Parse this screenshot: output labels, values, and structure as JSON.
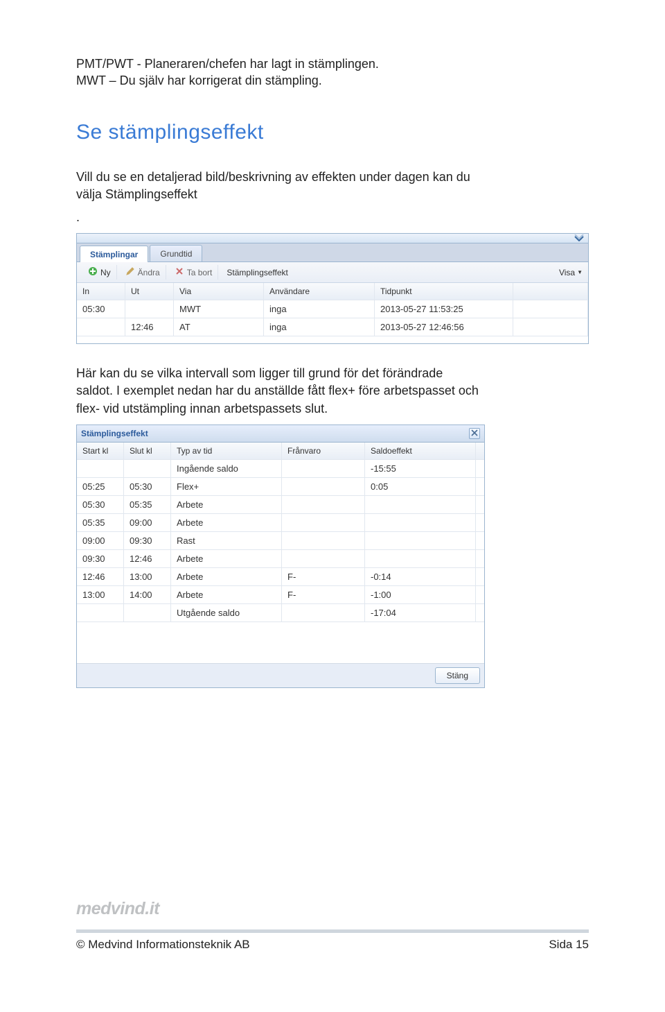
{
  "intro": {
    "line1": "PMT/PWT - Planeraren/chefen har lagt in stämplingen.",
    "line2": "MWT – Du själv har korrigerat din stämpling."
  },
  "heading": "Se stämplingseffekt",
  "body1_line1": "Vill du se en detaljerad bild/beskrivning av effekten under dagen kan du",
  "body1_line2": "välja Stämplingseffekt",
  "body1_period": ".",
  "panel1": {
    "tabs": {
      "t1": "Stämplingar",
      "t2": "Grundtid"
    },
    "toolbar": {
      "ny": "Ny",
      "andra": "Ändra",
      "tabort": "Ta bort",
      "link": "Stämplingseffekt",
      "visa": "Visa"
    },
    "head": {
      "c1": "In",
      "c2": "Ut",
      "c3": "Via",
      "c4": "Användare",
      "c5": "Tidpunkt"
    },
    "rows": [
      {
        "in": "05:30",
        "ut": "",
        "via": "MWT",
        "anv": "inga",
        "tid": "2013-05-27 11:53:25"
      },
      {
        "in": "",
        "ut": "12:46",
        "via": "AT",
        "anv": "inga",
        "tid": "2013-05-27 12:46:56"
      }
    ]
  },
  "body2_line1": "Här kan du se vilka intervall som ligger till grund för det förändrade",
  "body2_line2": "saldot. I exemplet nedan har du anställde fått flex+ före arbetspasset och",
  "body2_line3": "flex- vid utstämpling innan arbetspassets slut.",
  "panel2": {
    "title": "Stämplingseffekt",
    "head": {
      "c1": "Start kl",
      "c2": "Slut kl",
      "c3": "Typ av tid",
      "c4": "Frånvaro",
      "c5": "Saldoeffekt"
    },
    "rows": [
      {
        "s": "",
        "e": "",
        "typ": "Ingående saldo",
        "f": "",
        "sal": "-15:55"
      },
      {
        "s": "05:25",
        "e": "05:30",
        "typ": "Flex+",
        "f": "",
        "sal": "0:05"
      },
      {
        "s": "05:30",
        "e": "05:35",
        "typ": "Arbete",
        "f": "",
        "sal": ""
      },
      {
        "s": "05:35",
        "e": "09:00",
        "typ": "Arbete",
        "f": "",
        "sal": ""
      },
      {
        "s": "09:00",
        "e": "09:30",
        "typ": "Rast",
        "f": "",
        "sal": ""
      },
      {
        "s": "09:30",
        "e": "12:46",
        "typ": "Arbete",
        "f": "",
        "sal": ""
      },
      {
        "s": "12:46",
        "e": "13:00",
        "typ": "Arbete",
        "f": "F-",
        "sal": "-0:14"
      },
      {
        "s": "13:00",
        "e": "14:00",
        "typ": "Arbete",
        "f": "F-",
        "sal": "-1:00"
      },
      {
        "s": "",
        "e": "",
        "typ": "Utgående saldo",
        "f": "",
        "sal": "-17:04"
      }
    ],
    "close_btn": "Stäng"
  },
  "logo": "medvind.it",
  "footer": {
    "left": "© Medvind Informationsteknik AB",
    "right": "Sida 15"
  }
}
